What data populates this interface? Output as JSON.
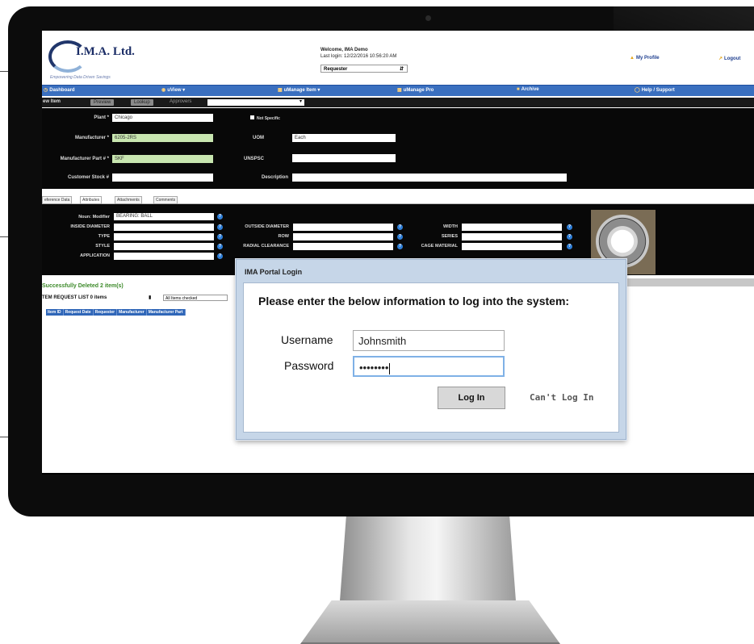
{
  "header": {
    "logo_text": "I.M.A. Ltd.",
    "logo_tagline": "Empowering Data Driven Savings",
    "welcome": "Welcome, IMA Demo",
    "last_login": "Last login: 12/22/2016 10:56:20 AM",
    "role": "Requester",
    "my_profile": "My Profile",
    "logout": "Logout"
  },
  "nav": {
    "items": [
      "Dashboard",
      "uView",
      "uManage Item",
      "uManage Pro",
      "Archive",
      "Help / Support"
    ]
  },
  "toolbar": {
    "title": "ew Item",
    "btn_preview": "Preview",
    "btn_lookup": "Lookup",
    "approvers": "Approvers"
  },
  "form": {
    "plant_label": "Plant *",
    "plant_value": "Chicago",
    "not_specific": "Not Specific",
    "manufacturer_label": "Manufacturer *",
    "manufacturer_value": "6205-2RS",
    "uom_label": "UOM",
    "uom_value": "Each",
    "mfr_part_label": "Manufacturer Part # *",
    "mfr_part_value": "SKF",
    "unspsc_label": "UNSPSC",
    "customer_stock_label": "Customer Stock #",
    "description_label": "Description"
  },
  "tabs": [
    "eference Data",
    "Attributes",
    "Attachments",
    "Comments"
  ],
  "attributes": {
    "noun_modifier_label": "Noun: Modifier",
    "noun_modifier_value": "BEARING: BALL",
    "inside_diameter": "INSIDE DIAMETER",
    "type": "TYPE",
    "style": "STYLE",
    "application": "APPLICATION",
    "outside_diameter": "OUTSIDE DIAMETER",
    "row": "ROW",
    "radial_clearance": "RADIAL CLEARANCE",
    "width": "WIDTH",
    "series": "SERIES",
    "cage_material": "CAGE MATERIAL"
  },
  "list": {
    "status": "Successfully Deleted 2 item(s)",
    "title": "TEM REQUEST LIST 0 items",
    "filter": "All Items checked",
    "columns": [
      "Item ID",
      "Request Date",
      "Requester",
      "Manufacturer",
      "Manufacturer Part"
    ]
  },
  "dialog": {
    "title": "IMA Portal Login",
    "prompt": "Please enter the below information to log into the system:",
    "username_label": "Username",
    "username_value": "Johnsmith",
    "password_label": "Password",
    "password_value": "••••••••",
    "login_button": "Log In",
    "cant_login": "Can't Log In"
  }
}
